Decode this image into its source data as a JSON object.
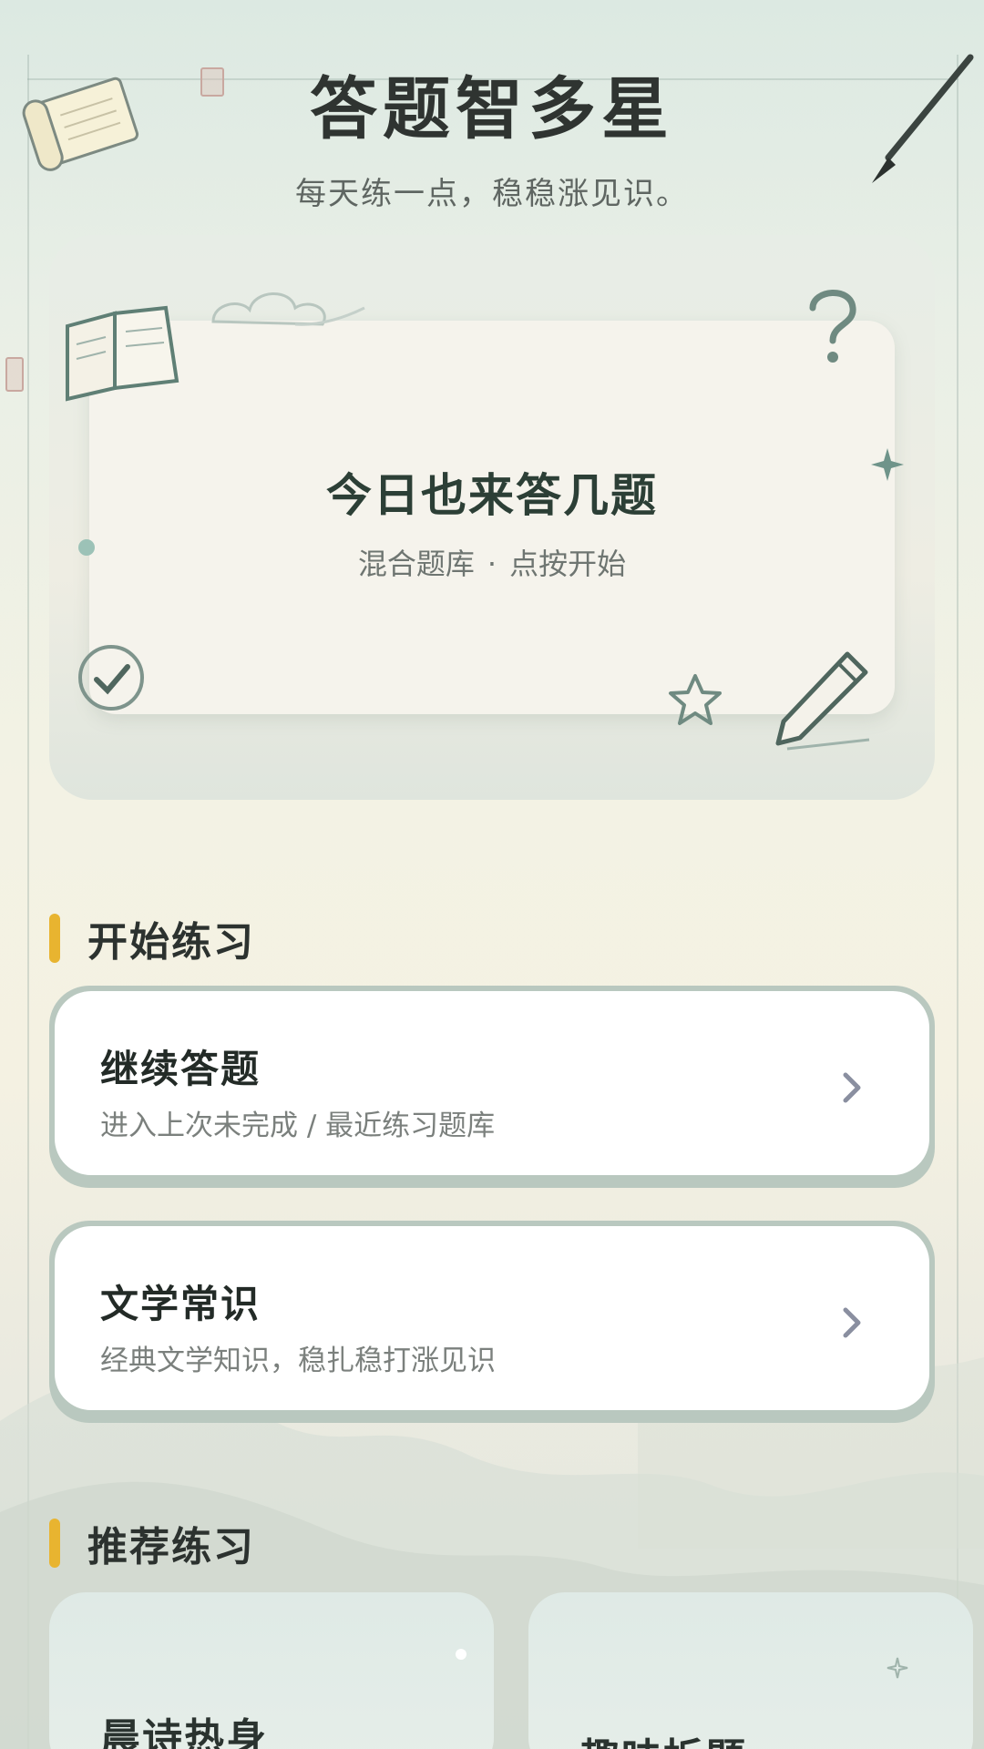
{
  "header": {
    "title": "答题智多星",
    "subtitle": "每天练一点，稳稳涨见识。"
  },
  "hero": {
    "title": "今日也来答几题",
    "subtitle_left": "混合题库",
    "subtitle_dot": "·",
    "subtitle_right": "点按开始"
  },
  "start_section": {
    "title": "开始练习",
    "items": [
      {
        "title": "继续答题",
        "desc": "进入上次未完成 / 最近练习题库"
      },
      {
        "title": "文学常识",
        "desc": "经典文学知识，稳扎稳打涨见识"
      }
    ]
  },
  "recommend_section": {
    "title": "推荐练习",
    "items": [
      {
        "title": "晨诗热身"
      },
      {
        "title": "趣味拆题"
      }
    ]
  },
  "colors": {
    "accent_bar": "#e8b430",
    "card_border": "#b9c8bf",
    "title_text": "#2c3f36"
  }
}
